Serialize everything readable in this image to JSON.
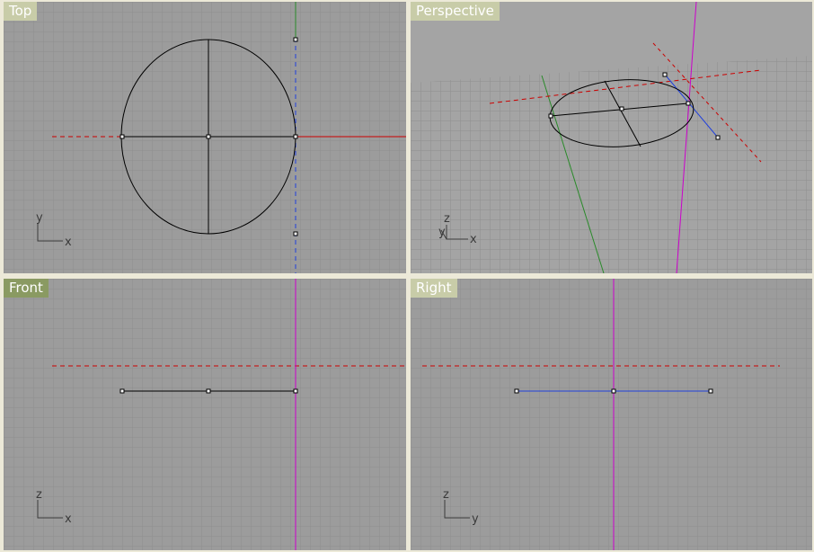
{
  "viewports": [
    {
      "name": "Top",
      "active": false,
      "axes": [
        "y",
        "x"
      ]
    },
    {
      "name": "Perspective",
      "active": false,
      "axes": [
        "z",
        "y",
        "x"
      ]
    },
    {
      "name": "Front",
      "active": true,
      "axes": [
        "z",
        "x"
      ]
    },
    {
      "name": "Right",
      "active": false,
      "axes": [
        "z",
        "y"
      ]
    }
  ],
  "colors": {
    "grid_bg": "#9c9c9c",
    "grid_line": "#8e8e8e",
    "grid_major": "#7e7e7e",
    "x_axis": "#cc0000",
    "y_axis": "#2a8a2a",
    "z_axis": "#cc00cc",
    "label_active": "#8a9a62",
    "label_inactive": "#c8cca8"
  }
}
